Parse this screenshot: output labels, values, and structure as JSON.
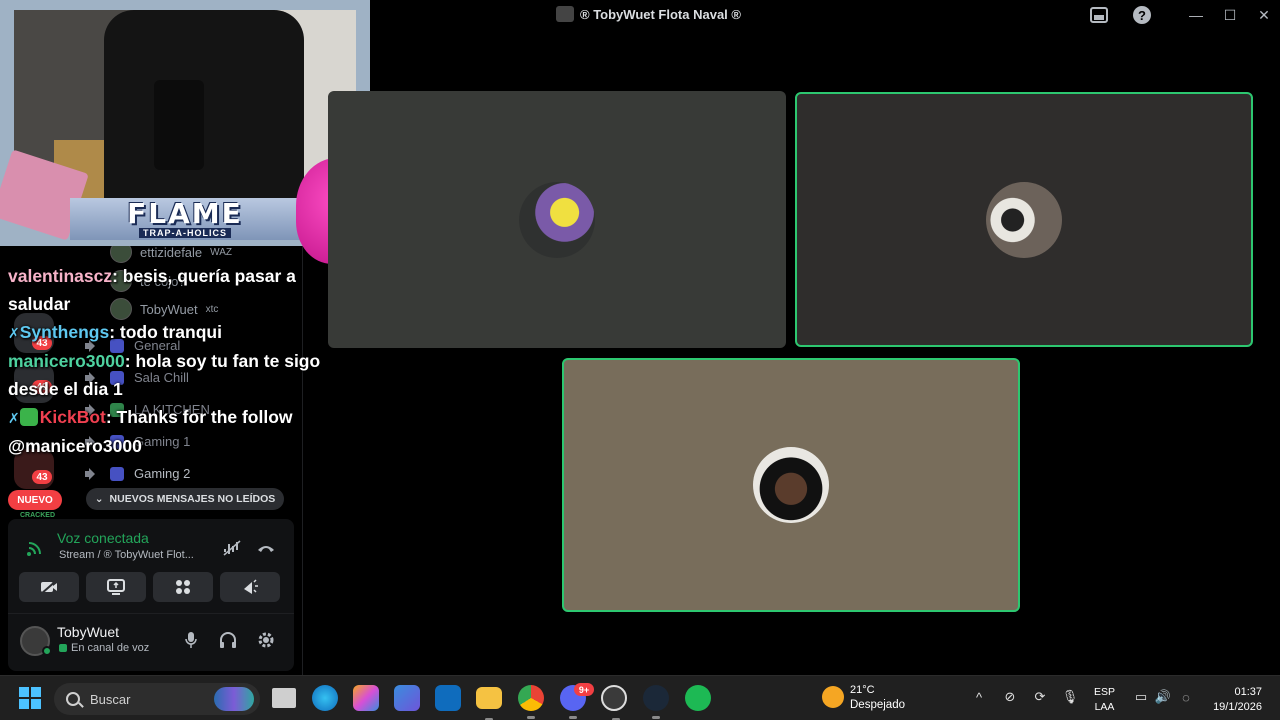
{
  "window": {
    "title": "® TobyWuet Flota Naval ®"
  },
  "sidebar": {
    "members": [
      {
        "name": "ettizidefale",
        "tag": "WAZ"
      },
      {
        "name": "te cojo?",
        "tag": ""
      },
      {
        "name": "TobyWuet",
        "tag": "xtc"
      }
    ],
    "channels": [
      {
        "label": "General"
      },
      {
        "label": "Sala Chill"
      },
      {
        "label": "LA KITCHEN"
      },
      {
        "label": "Gaming 1"
      },
      {
        "label": "Gaming 2"
      }
    ],
    "badges": [
      "43",
      "43",
      "43"
    ],
    "nuevo_label": "NUEVO",
    "new_messages_label": "NUEVOS MENSAJES NO LEÍDOS",
    "cracked_label": "CRACKED"
  },
  "voice": {
    "status": "Voz conectada",
    "location": "Stream / ® TobyWuet Flot..."
  },
  "user": {
    "name": "TobyWuet",
    "status": "En canal de voz"
  },
  "overlay": {
    "brand": "FLAME",
    "brand_sub": "TRAP-A-HOLICS",
    "chat": [
      {
        "user": "valentinascz",
        "text": ": besis, quería pasar a saludar"
      },
      {
        "user": "Synthengs",
        "text": ": todo tranqui"
      },
      {
        "user": "manicero3000",
        "text": ": hola soy tu fan te sigo desde el dia 1"
      },
      {
        "user": "KickBot",
        "text": ": Thanks for the follow @manicero3000"
      }
    ]
  },
  "taskbar": {
    "search_placeholder": "Buscar",
    "weather_temp": "21°C",
    "weather_desc": "Despejado",
    "lang_1": "ESP",
    "lang_2": "LAA",
    "time": "01:37",
    "date": "19/1/2026",
    "discord_badge": "9+"
  },
  "colors": {
    "speaking_border": "#2dc770",
    "voice_connected": "#23a55a",
    "badge_red": "#f23f43"
  }
}
